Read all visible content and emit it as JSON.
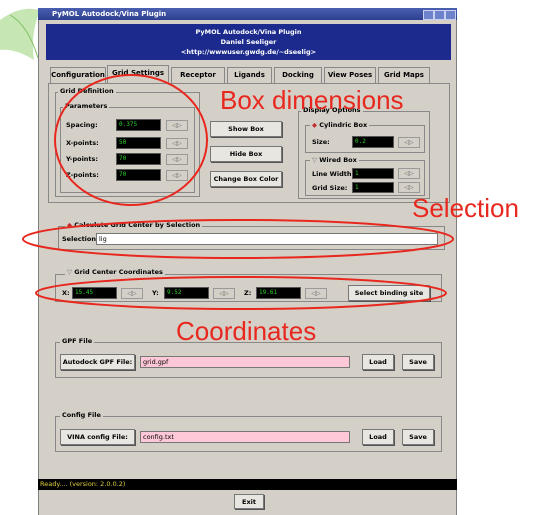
{
  "window": {
    "title": "PyMOL Autodock/Vina Plugin",
    "header_lines": [
      "PyMOL Autodock/Vina Plugin",
      "Daniel Seeliger",
      "<http://wwwuser.gwdg.de/~dseelig>"
    ]
  },
  "tabs": [
    {
      "label": "Configuration"
    },
    {
      "label": "Grid Settings",
      "active": true
    },
    {
      "label": "Receptor"
    },
    {
      "label": "Ligands"
    },
    {
      "label": "Docking"
    },
    {
      "label": "View Poses"
    },
    {
      "label": "Grid Maps"
    }
  ],
  "grid_definition": {
    "title": "Grid Definition",
    "parameters_title": "Parameters",
    "spacing_label": "Spacing:",
    "spacing_value": "0.375",
    "xpoints_label": "X-points:",
    "xpoints_value": "50",
    "ypoints_label": "Y-points:",
    "ypoints_value": "70",
    "zpoints_label": "Z-points:",
    "zpoints_value": "70"
  },
  "box_buttons": {
    "show": "Show Box",
    "hide": "Hide Box",
    "color": "Change Box Color"
  },
  "display_options": {
    "title": "Display Options",
    "cyl_title": "Cylindric Box",
    "size_label": "Size:",
    "size_value": "0.2",
    "wired_title": "Wired Box",
    "linewidth_label": "Line Width:",
    "linewidth_value": "1",
    "gridsize_label": "Grid Size:",
    "gridsize_value": "1"
  },
  "selection": {
    "radio_label": "Calculate Grid Center by Selection",
    "field_label": "Selection",
    "field_value": "lig"
  },
  "center": {
    "title": "Grid Center Coordinates",
    "x_label": "X:",
    "x_value": "15.45",
    "y_label": "Y:",
    "y_value": "9.52",
    "z_label": "Z:",
    "z_value": "19.61",
    "button": "Select binding site"
  },
  "gpf": {
    "title": "GPF File",
    "label": "Autodock GPF File:",
    "value": "grid.gpf",
    "load": "Load",
    "save": "Save"
  },
  "config": {
    "title": "Config File",
    "label": "VINA config File:",
    "value": "config.txt",
    "load": "Load",
    "save": "Save"
  },
  "status": "Ready.... (version: 2.0.0.2)",
  "exit_label": "Exit",
  "annotations": {
    "box": "Box dimensions",
    "selection": "Selection",
    "coordinates": "Coordinates",
    "color": "#e8281e"
  }
}
